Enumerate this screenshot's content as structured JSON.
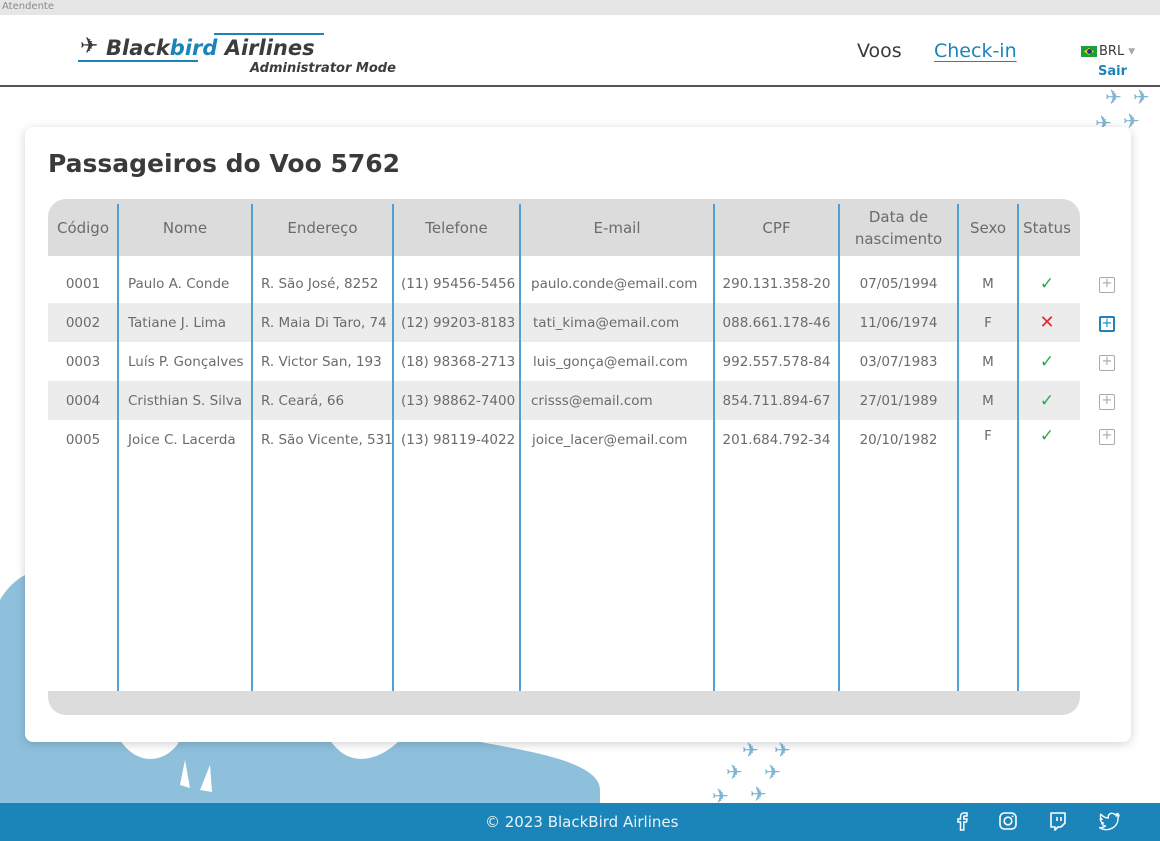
{
  "window": {
    "label": "Atendente"
  },
  "header": {
    "logo": {
      "brand_part1": "Black",
      "brand_part2": "bird",
      "brand_part3": " Airlines",
      "subtitle": "Administrator Mode"
    },
    "nav": {
      "voos": "Voos",
      "checkin": "Check-in"
    },
    "currency": "BRL",
    "logout": "Sair"
  },
  "main": {
    "title": "Passageiros do Voo 5762",
    "columns": [
      "Código",
      "Nome",
      "Endereço",
      "Telefone",
      "E-mail",
      "CPF",
      "Data de nascimento",
      "Sexo",
      "Status"
    ],
    "rows": [
      {
        "codigo": "0001",
        "nome": "Paulo A. Conde",
        "endereco": "R. São José, 8252",
        "telefone": "(11) 95456-5456",
        "email": "paulo.conde@email.com",
        "cpf": "290.131.358-20",
        "nascimento": "07/05/1994",
        "sexo": "M",
        "status": "✓"
      },
      {
        "codigo": "0002",
        "nome": "Tatiane J. Lima",
        "endereco": "R. Maia Di Taro, 74",
        "telefone": "(12) 99203-8183",
        "email": "tati_kima@email.com",
        "cpf": "088.661.178-46",
        "nascimento": "11/06/1974",
        "sexo": "F",
        "status": "✕"
      },
      {
        "codigo": "0003",
        "nome": "Luís P. Gonçalves",
        "endereco": "R. Victor San, 193",
        "telefone": "(18) 98368-2713",
        "email": "luis_gonça@email.com",
        "cpf": "992.557.578-84",
        "nascimento": "03/07/1983",
        "sexo": "M",
        "status": "✓"
      },
      {
        "codigo": "0004",
        "nome": "Cristhian S. Silva",
        "endereco": "R. Ceará, 66",
        "telefone": "(13) 98862-7400",
        "email": "crisss@email.com",
        "cpf": "854.711.894-67",
        "nascimento": "27/01/1989",
        "sexo": "M",
        "status": "✓"
      },
      {
        "codigo": "0005",
        "nome": "Joice C. Lacerda",
        "endereco": "R. São Vicente, 531",
        "telefone": "(13) 98119-4022",
        "email": "joice_lacer@email.com",
        "cpf": "201.684.792-34",
        "nascimento": "20/10/1982",
        "sexo": "F",
        "status": "✓"
      }
    ],
    "expand_glyph": "+"
  },
  "footer": {
    "copyright": "© 2023 BlackBird Airlines"
  },
  "icons": {
    "logo": "airplane-icon",
    "social": [
      "facebook-icon",
      "instagram-icon",
      "twitch-icon",
      "twitter-icon"
    ]
  },
  "colors": {
    "accent": "#1b84b8",
    "ok": "#2aa84a",
    "error": "#e02b2b"
  }
}
